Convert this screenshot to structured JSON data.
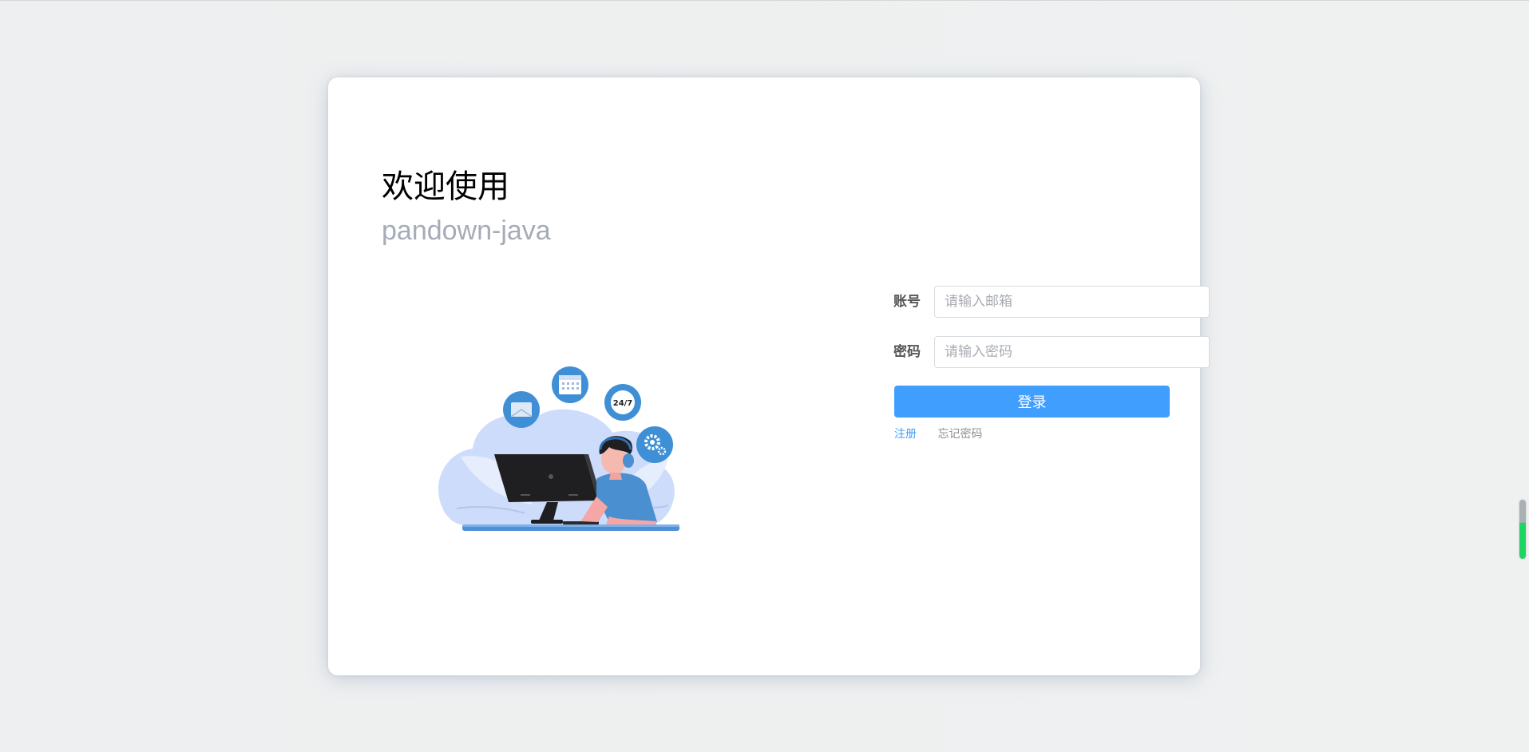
{
  "welcome": {
    "title": "欢迎使用",
    "app_name": "pandown-java"
  },
  "login_form": {
    "account_label": "账号",
    "account_placeholder": "请输入邮箱",
    "password_label": "密码",
    "password_placeholder": "请输入密码",
    "login_button": "登录"
  },
  "links": {
    "register": "注册",
    "forgot_password": "忘记密码"
  },
  "illustration": {
    "badge_text": "24/7",
    "icons": [
      "mail-icon",
      "calendar-icon",
      "clock-24-7-icon",
      "gears-icon"
    ]
  },
  "colors": {
    "primary": "#409eff",
    "app_name": "#a6acb7",
    "link_register": "#409eff",
    "link_forgot": "#8c8f94"
  }
}
